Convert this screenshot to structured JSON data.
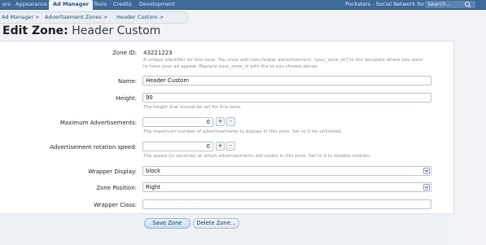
{
  "nav": {
    "tabs": [
      {
        "label": "ers",
        "active": false
      },
      {
        "label": "Appearance",
        "active": false
      },
      {
        "label": "Ad Manager",
        "active": true
      },
      {
        "label": "Tools",
        "active": false
      },
      {
        "label": "Credits",
        "active": false
      },
      {
        "label": "Development",
        "active": false
      }
    ],
    "site_name": "Pucksters - Social Network for the",
    "search_placeholder": "Search..."
  },
  "breadcrumb": [
    "Ad Manager >",
    "Advertisement Zones >",
    "Header Custom >"
  ],
  "title": {
    "prefix": "Edit Zone:",
    "name": "Header Custom"
  },
  "form": {
    "zone_id": {
      "label": "Zone ID:",
      "value": "43221223",
      "hint1": "A unique identifier for this zone. You must add [xen:helper advertisement, 'your_zone_id'] to the template where you want",
      "hint2": "to have your ad appear. Replace your_zone_id with the id you choose above."
    },
    "name": {
      "label": "Name:",
      "value": "Header Custom"
    },
    "height": {
      "label": "Height:",
      "value": "90",
      "hint": "The height that should be set for this zone."
    },
    "max_ads": {
      "label": "Maximum Advertisements:",
      "value": "0",
      "hint": "The maximum number of advertisements to display in this zone. Set to 0 for unlimited."
    },
    "rotation": {
      "label": "Advertisement rotation speed:",
      "value": "0",
      "hint": "The speed (in seconds) at which advertisements will rotate in this zone. Set to 0 to disable rotation."
    },
    "wrapper_display": {
      "label": "Wrapper Display:",
      "value": "block"
    },
    "zone_position": {
      "label": "Zone Position:",
      "value": "Right"
    },
    "wrapper_class": {
      "label": "Wrapper Class:",
      "value": ""
    },
    "plus": "+",
    "minus": "-"
  },
  "buttons": {
    "save": "Save Zone",
    "delete": "Delete Zone..."
  }
}
